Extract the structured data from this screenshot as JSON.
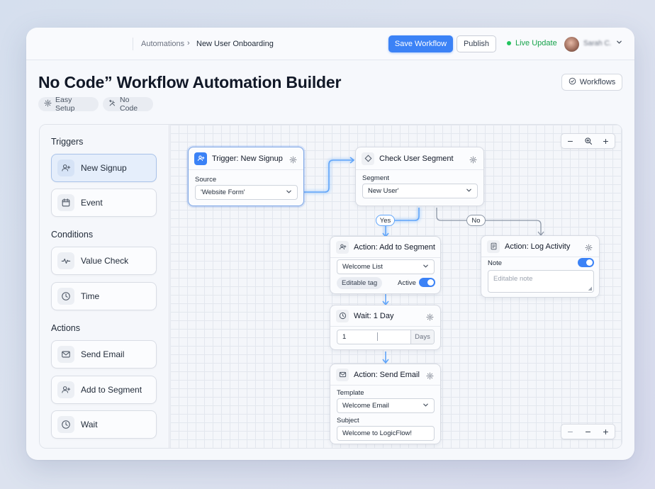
{
  "topbar": {
    "breadcrumb_root": "Automations",
    "breadcrumb_sep": "›",
    "breadcrumb_current": "New User Onboarding",
    "save_label": "Save Workflow",
    "publish_label": "Publish",
    "live_label": "Live Update",
    "user_name": "Sarah C."
  },
  "header": {
    "title": "No Code” Workflow Automation Builder",
    "tags": [
      "Easy Setup",
      "No Code"
    ],
    "workflows_label": "Workflows"
  },
  "sidebar": {
    "triggers_heading": "Triggers",
    "triggers": [
      {
        "label": "New Signup",
        "icon": "user-plus-icon",
        "selected": true
      },
      {
        "label": "Event",
        "icon": "calendar-icon",
        "selected": false
      }
    ],
    "conditions_heading": "Conditions",
    "conditions": [
      {
        "label": "Value Check",
        "icon": "pulse-icon"
      },
      {
        "label": "Time",
        "icon": "clock-icon"
      }
    ],
    "actions_heading": "Actions",
    "actions": [
      {
        "label": "Send Email",
        "icon": "mail-icon"
      },
      {
        "label": "Add to Segment",
        "icon": "user-plus-icon"
      },
      {
        "label": "Wait",
        "icon": "clock-icon"
      }
    ]
  },
  "canvas": {
    "trigger_node": {
      "title": "Trigger: New Signup",
      "field_label": "Source",
      "field_value": "'Website Form'"
    },
    "segment_node": {
      "title": "Check User Segment",
      "field_label": "Segment",
      "field_value": "New User'"
    },
    "edge_yes": "Yes",
    "edge_no": "No",
    "add_segment_node": {
      "title": "Action: Add to Segment",
      "select_value": "Welcome List",
      "tag_label": "Editable tag",
      "active_label": "Active",
      "active": true
    },
    "log_node": {
      "title": "Action: Log Activity",
      "note_label": "Note",
      "note_placeholder": "Editable note",
      "note_enabled": true
    },
    "wait_node": {
      "title": "Wait: 1 Day",
      "value": "1",
      "unit": "Days"
    },
    "email_node": {
      "title": "Action: Send Email",
      "template_label": "Template",
      "template_value": "Welcome Email",
      "subject_label": "Subject",
      "subject_value": "Welcome to LogicFlow!"
    },
    "zoom_controls": [
      "−",
      "⊕",
      "+"
    ],
    "bottom_controls": [
      "−",
      "−",
      "+"
    ]
  },
  "colors": {
    "accent": "#3b82f6",
    "live": "#22c55e",
    "wire_active": "#60a5fa",
    "wire_inactive": "#8c96a6"
  }
}
